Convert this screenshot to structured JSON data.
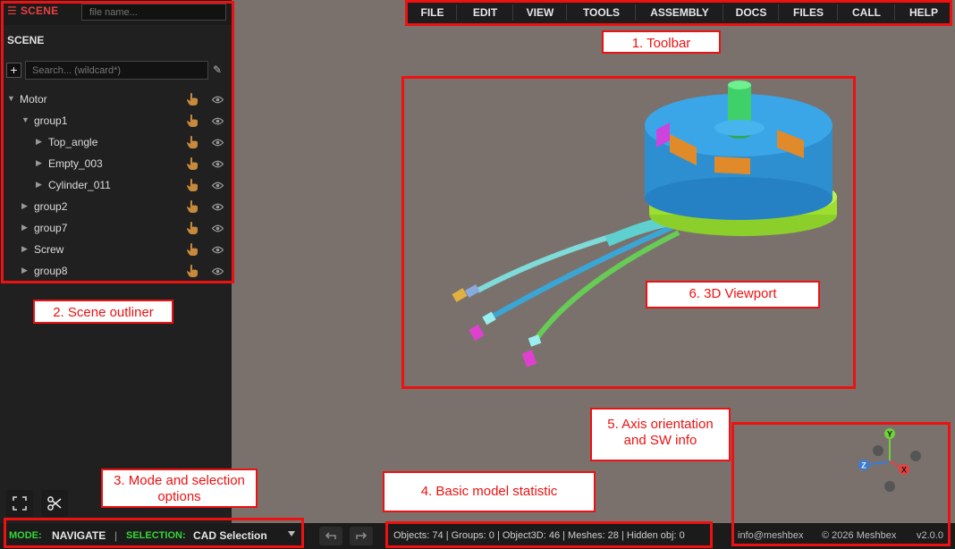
{
  "sidebar": {
    "tab_label": "SCENE",
    "file_placeholder": "file name...",
    "title": "SCENE",
    "add_label": "+",
    "search_placeholder": "Search... (wildcard*)",
    "tree": [
      {
        "label": "Motor",
        "depth": 0,
        "expanded": true
      },
      {
        "label": "group1",
        "depth": 1,
        "expanded": true
      },
      {
        "label": "Top_angle",
        "depth": 2,
        "expanded": false
      },
      {
        "label": "Empty_003",
        "depth": 2,
        "expanded": false
      },
      {
        "label": "Cylinder_011",
        "depth": 2,
        "expanded": false
      },
      {
        "label": "group2",
        "depth": 1,
        "expanded": false
      },
      {
        "label": "group7",
        "depth": 1,
        "expanded": false
      },
      {
        "label": "Screw",
        "depth": 1,
        "expanded": false
      },
      {
        "label": "group8",
        "depth": 1,
        "expanded": false
      }
    ]
  },
  "toolbar": {
    "items": [
      "FILE",
      "EDIT",
      "VIEW",
      "TOOLS",
      "ASSEMBLY",
      "DOCS",
      "FILES",
      "CALL",
      "HELP"
    ]
  },
  "statusbar": {
    "mode_label": "MODE:",
    "mode_value": "NAVIGATE",
    "separator": "|",
    "selection_label": "SELECTION:",
    "selection_value": "CAD Selection",
    "stats": "Objects: 74 | Groups: 0 | Object3D: 46 | Meshes: 28 | Hidden obj: 0",
    "email": "info@meshbex",
    "copyright": "© 2026 Meshbex",
    "version": "v2.0.0"
  },
  "axis": {
    "y": "Y",
    "z": "Z",
    "x": "X"
  },
  "annotations": {
    "toolbar": "1. Toolbar",
    "outliner": "2. Scene outliner",
    "mode": "3. Mode and selection options",
    "stats": "4. Basic model statistic",
    "axis": "5. Axis orientation and SW info",
    "viewport": "6. 3D Viewport"
  },
  "colors": {
    "accent_red": "#ee1111",
    "mode_green": "#36d636",
    "viewport_bg": "#7a716c"
  }
}
